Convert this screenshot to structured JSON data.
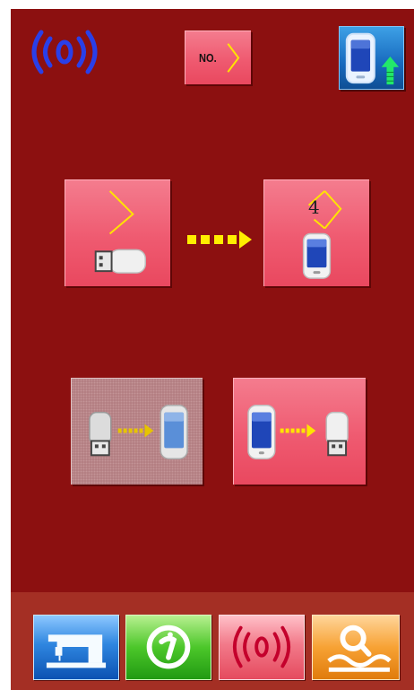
{
  "header": {
    "no_label": "NO.",
    "status_icon": "wireless-icon",
    "panel_icon": "panel-upload-icon"
  },
  "transfer": {
    "target_number": "4",
    "source_icon": "usb-drive-icon",
    "target_icon": "panel-device-icon",
    "arrow_icon": "dotted-arrow-icon"
  },
  "modes": [
    {
      "name": "usb-to-panel",
      "selected": true
    },
    {
      "name": "panel-to-usb",
      "selected": false
    }
  ],
  "footer": {
    "buttons": [
      {
        "icon": "sewing-machine-icon"
      },
      {
        "icon": "info-icon"
      },
      {
        "icon": "wireless-icon"
      },
      {
        "icon": "search-icon"
      }
    ]
  },
  "colors": {
    "background": "#8c1010",
    "footer": "#a42f24",
    "pink_button": "#ef5a70",
    "diamond": "#ffe400",
    "arrow": "#ffee00",
    "upload_arrow": "#22e86a"
  }
}
